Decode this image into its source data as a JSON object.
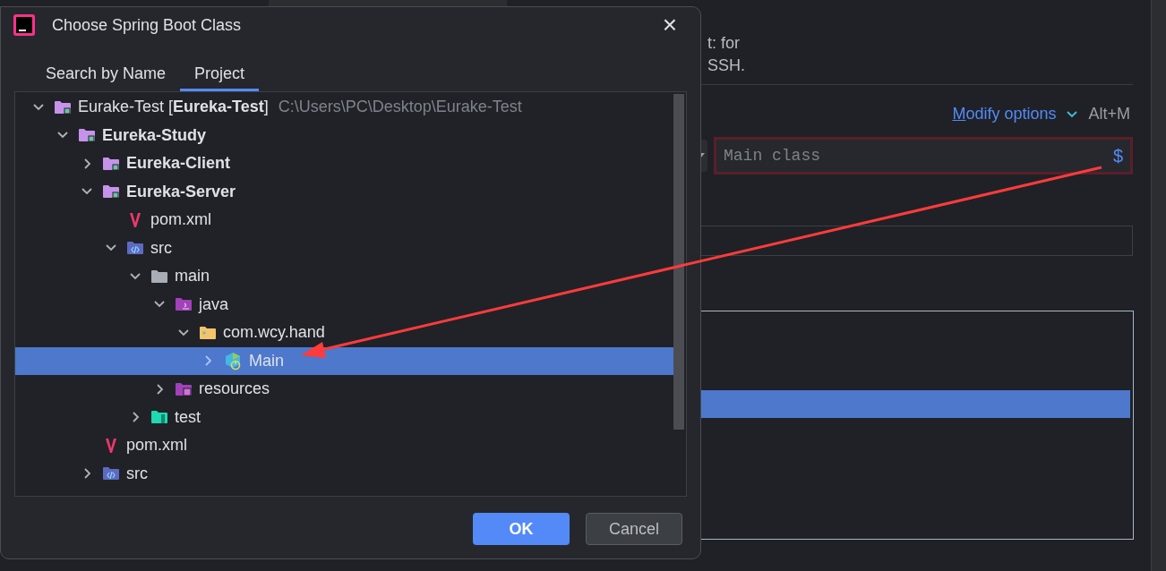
{
  "background": {
    "note_line_1": "t: for",
    "note_line_2": "SSH.",
    "modify_options": "Modify options",
    "modify_shortcut": "Alt+M",
    "main_class": {
      "placeholder": "Main class",
      "macro": "$",
      "error": true
    }
  },
  "dialog": {
    "title": "Choose Spring Boot Class",
    "close": "×",
    "tabs": [
      {
        "label": "Search by Name",
        "selected": false
      },
      {
        "label": "Project",
        "selected": true
      }
    ],
    "tree": [
      {
        "name": "Eurake-Test [**Eureka-Test**]",
        "path": "C:\\Users\\PC\\Desktop\\Eurake-Test",
        "kind": "project",
        "expanded": true,
        "selected": false,
        "children": [
          {
            "name": "Eureka-Study",
            "kind": "module",
            "expanded": true,
            "selected": false,
            "children": [
              {
                "name": "Eureka-Client",
                "kind": "module",
                "expanded": false,
                "selected": false
              },
              {
                "name": "Eureka-Server",
                "kind": "module",
                "expanded": true,
                "selected": false,
                "children": [
                  {
                    "name": "pom.xml",
                    "kind": "maven",
                    "selected": false
                  },
                  {
                    "name": "src",
                    "kind": "source",
                    "expanded": true,
                    "selected": false,
                    "children": [
                      {
                        "name": "main",
                        "kind": "folder",
                        "expanded": true,
                        "selected": false,
                        "children": [
                          {
                            "name": "java",
                            "kind": "java",
                            "expanded": true,
                            "selected": false,
                            "children": [
                              {
                                "name": "com.wcy.hand",
                                "kind": "package",
                                "expanded": true,
                                "selected": false,
                                "children": [
                                  {
                                    "name": "Main",
                                    "kind": "class",
                                    "expanded": false,
                                    "selected": true
                                  }
                                ]
                              }
                            ]
                          },
                          {
                            "name": "resources",
                            "kind": "resources",
                            "expanded": false,
                            "selected": false
                          }
                        ]
                      },
                      {
                        "name": "test",
                        "kind": "test",
                        "expanded": false,
                        "selected": false
                      }
                    ]
                  }
                ]
              },
              {
                "name": "pom.xml",
                "kind": "maven",
                "selected": false
              },
              {
                "name": "src",
                "kind": "source",
                "expanded": false,
                "selected": false
              }
            ]
          }
        ]
      }
    ],
    "buttons": [
      {
        "label": "OK",
        "kind": "primary"
      },
      {
        "label": "Cancel",
        "kind": "secondary"
      }
    ]
  }
}
